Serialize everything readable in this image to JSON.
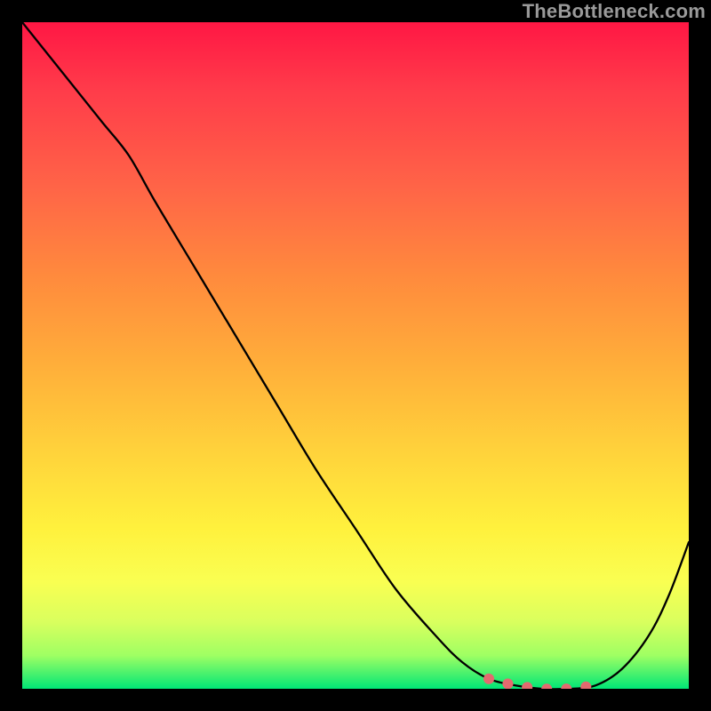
{
  "watermark": "TheBottleneck.com",
  "colors": {
    "page_bg": "#000000",
    "curve": "#000000",
    "trough_dots": "#e36a6f",
    "watermark": "#9a9a9a",
    "gradient_top": "#ff1744",
    "gradient_mid": "#ffd43b",
    "gradient_bottom": "#00e676"
  },
  "chart_data": {
    "type": "line",
    "title": "",
    "xlabel": "",
    "ylabel": "",
    "x": [
      0.0,
      0.04,
      0.08,
      0.12,
      0.16,
      0.2,
      0.26,
      0.32,
      0.38,
      0.44,
      0.5,
      0.56,
      0.62,
      0.66,
      0.7,
      0.74,
      0.78,
      0.82,
      0.86,
      0.9,
      0.94,
      0.97,
      1.0
    ],
    "values": [
      1.0,
      0.95,
      0.9,
      0.85,
      0.8,
      0.73,
      0.63,
      0.53,
      0.43,
      0.33,
      0.24,
      0.15,
      0.08,
      0.04,
      0.015,
      0.005,
      0.0,
      0.0,
      0.005,
      0.03,
      0.08,
      0.14,
      0.22
    ],
    "xlim": [
      0,
      1
    ],
    "ylim": [
      0,
      1
    ],
    "grid": false,
    "trough_region_x": [
      0.7,
      0.88
    ],
    "annotations": []
  }
}
